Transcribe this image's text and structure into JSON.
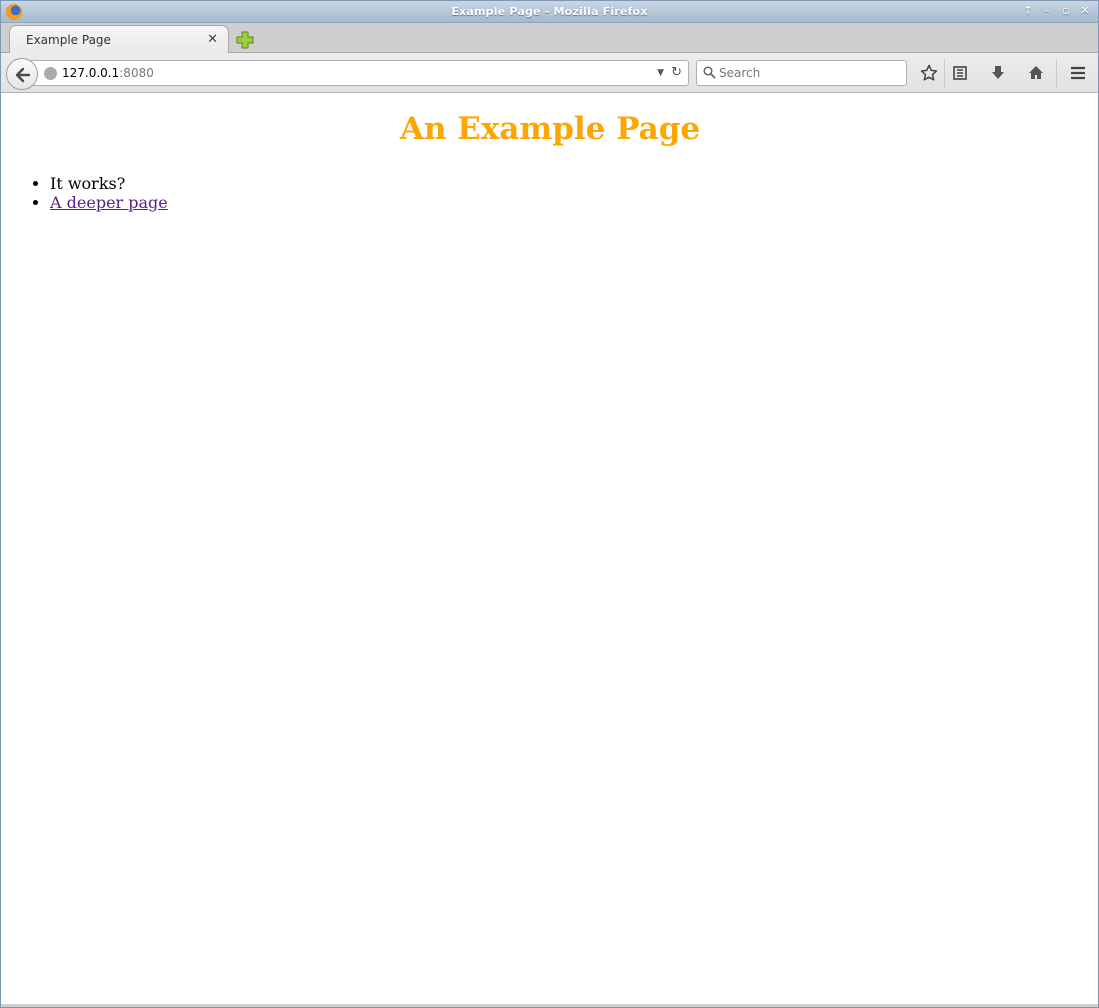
{
  "window": {
    "title": "Example Page - Mozilla Firefox"
  },
  "tabs": [
    {
      "label": "Example Page",
      "active": true
    }
  ],
  "navbar": {
    "url_host": "127.0.0.1",
    "url_port": ":8080",
    "search_placeholder": "Search"
  },
  "page": {
    "heading": "An Example Page",
    "heading_color": "#ffa500",
    "items": [
      {
        "text": "It works?"
      },
      {
        "text": "A deeper page",
        "link": true,
        "color": "#551a8b"
      }
    ]
  },
  "icons": {
    "toolbar": [
      "bookmark-star-icon",
      "reading-list-icon",
      "downloads-icon",
      "home-icon",
      "menu-icon"
    ]
  }
}
